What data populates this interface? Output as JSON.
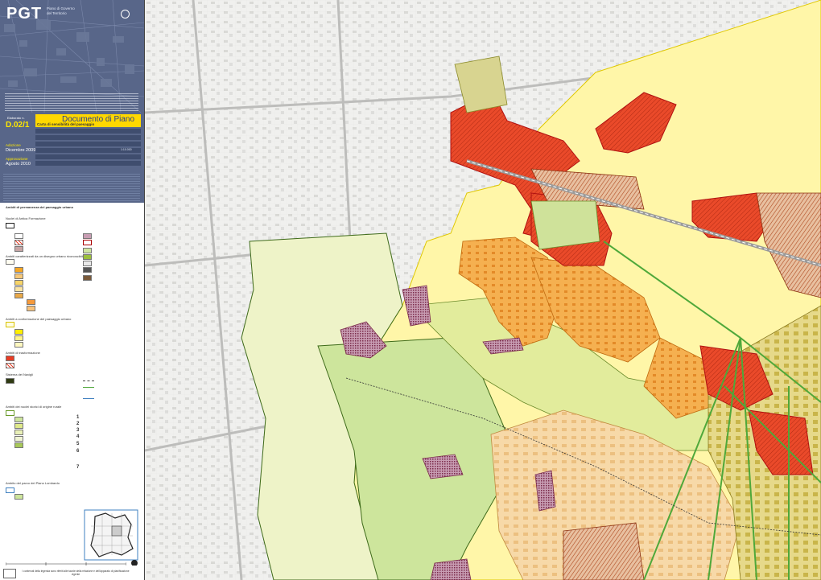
{
  "app": {
    "title": "PGT"
  },
  "header": {
    "logo_text": "PGT",
    "piano_line1": "Piano di Governo",
    "piano_line2": "del Territorio"
  },
  "title_block": {
    "code_label": "Elaborato n.",
    "code": "D.02/1",
    "document": "Documento di Piano",
    "subtitle": "Carta di sensibilità del paesaggio",
    "date_label_1": "Adozione",
    "date_1": "Dicembre 2009",
    "date_label_2": "Approvazione",
    "date_2": "Agosto 2010",
    "scale": "1:10.000"
  },
  "legend": {
    "title": "Ambiti di permanenza del paesaggio urbano",
    "sections": [
      {
        "title": "Nuclei di Antica Formazione"
      },
      {
        "title": "Ambiti caratterizzati da un disegno urbano riconoscibile"
      },
      {
        "title": "Ambiti a conformazione del paesaggio urbano"
      },
      {
        "title": "Ambiti di trasformazione"
      },
      {
        "title": "Sistema dei Navigli"
      },
      {
        "title": "Ambiti dei nuclei storici di origine rurale"
      },
      {
        "title": "Ambito del parco del Piano Lombardo"
      }
    ],
    "numbers": [
      "1",
      "2",
      "3",
      "4",
      "5",
      "6",
      "7"
    ]
  },
  "footer": {
    "note": "I contenuti della legenda sono riferiti alle tavole della relazione e dell'apparato di pianificazione vigente"
  },
  "colors": {
    "nuclei": "#e83c24",
    "very_high": "#f5a623",
    "high": "#f7d468",
    "medium": "#ffee00",
    "low": "#dfe98a",
    "green": "#cde59c",
    "navigli": "#2f8a1f",
    "road": "#4fa83a"
  }
}
